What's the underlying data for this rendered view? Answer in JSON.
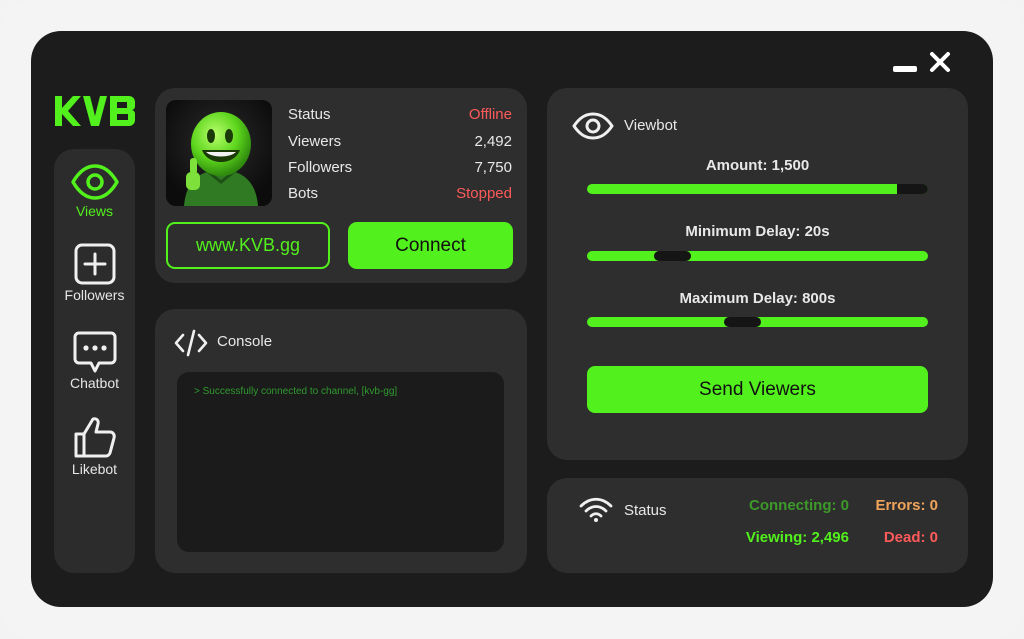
{
  "window": {
    "logo_text": "KVB"
  },
  "sidebar": {
    "items": [
      {
        "label": "Views",
        "icon": "eye-icon",
        "active": true
      },
      {
        "label": "Followers",
        "icon": "plus-square-icon",
        "active": false
      },
      {
        "label": "Chatbot",
        "icon": "chat-bubble-icon",
        "active": false
      },
      {
        "label": "Likebot",
        "icon": "thumbs-up-icon",
        "active": false
      }
    ]
  },
  "profile": {
    "stats": [
      {
        "label": "Status",
        "value": "Offline"
      },
      {
        "label": "Viewers",
        "value": "2,492"
      },
      {
        "label": "Followers",
        "value": "7,750"
      },
      {
        "label": "Bots",
        "value": "Stopped"
      }
    ],
    "site_label": "www.KVB.gg",
    "connect_label": "Connect"
  },
  "console": {
    "title": "Console",
    "lines": [
      "> Successfully connected to channel, [kvb-gg]"
    ]
  },
  "viewbot": {
    "title": "Viewbot",
    "sliders": [
      {
        "label": "Amount: 1,500",
        "level": 0.91
      },
      {
        "label": "Minimum Delay: 20s",
        "level": 0.22
      },
      {
        "label": "Maximum Delay: 800s",
        "level": 0.45
      }
    ],
    "send_label": "Send Viewers"
  },
  "status": {
    "title": "Status",
    "connecting": "Connecting: 0",
    "errors": "Errors: 0",
    "viewing": "Viewing: 2,496",
    "dead": "Dead: 0"
  },
  "colors": {
    "accent": "#52f01c",
    "danger": "#ff5a5a",
    "warning": "#f0a35a",
    "connecting": "#3d9a2a",
    "panel": "#2e2e2e",
    "window": "#1c1c1c"
  }
}
